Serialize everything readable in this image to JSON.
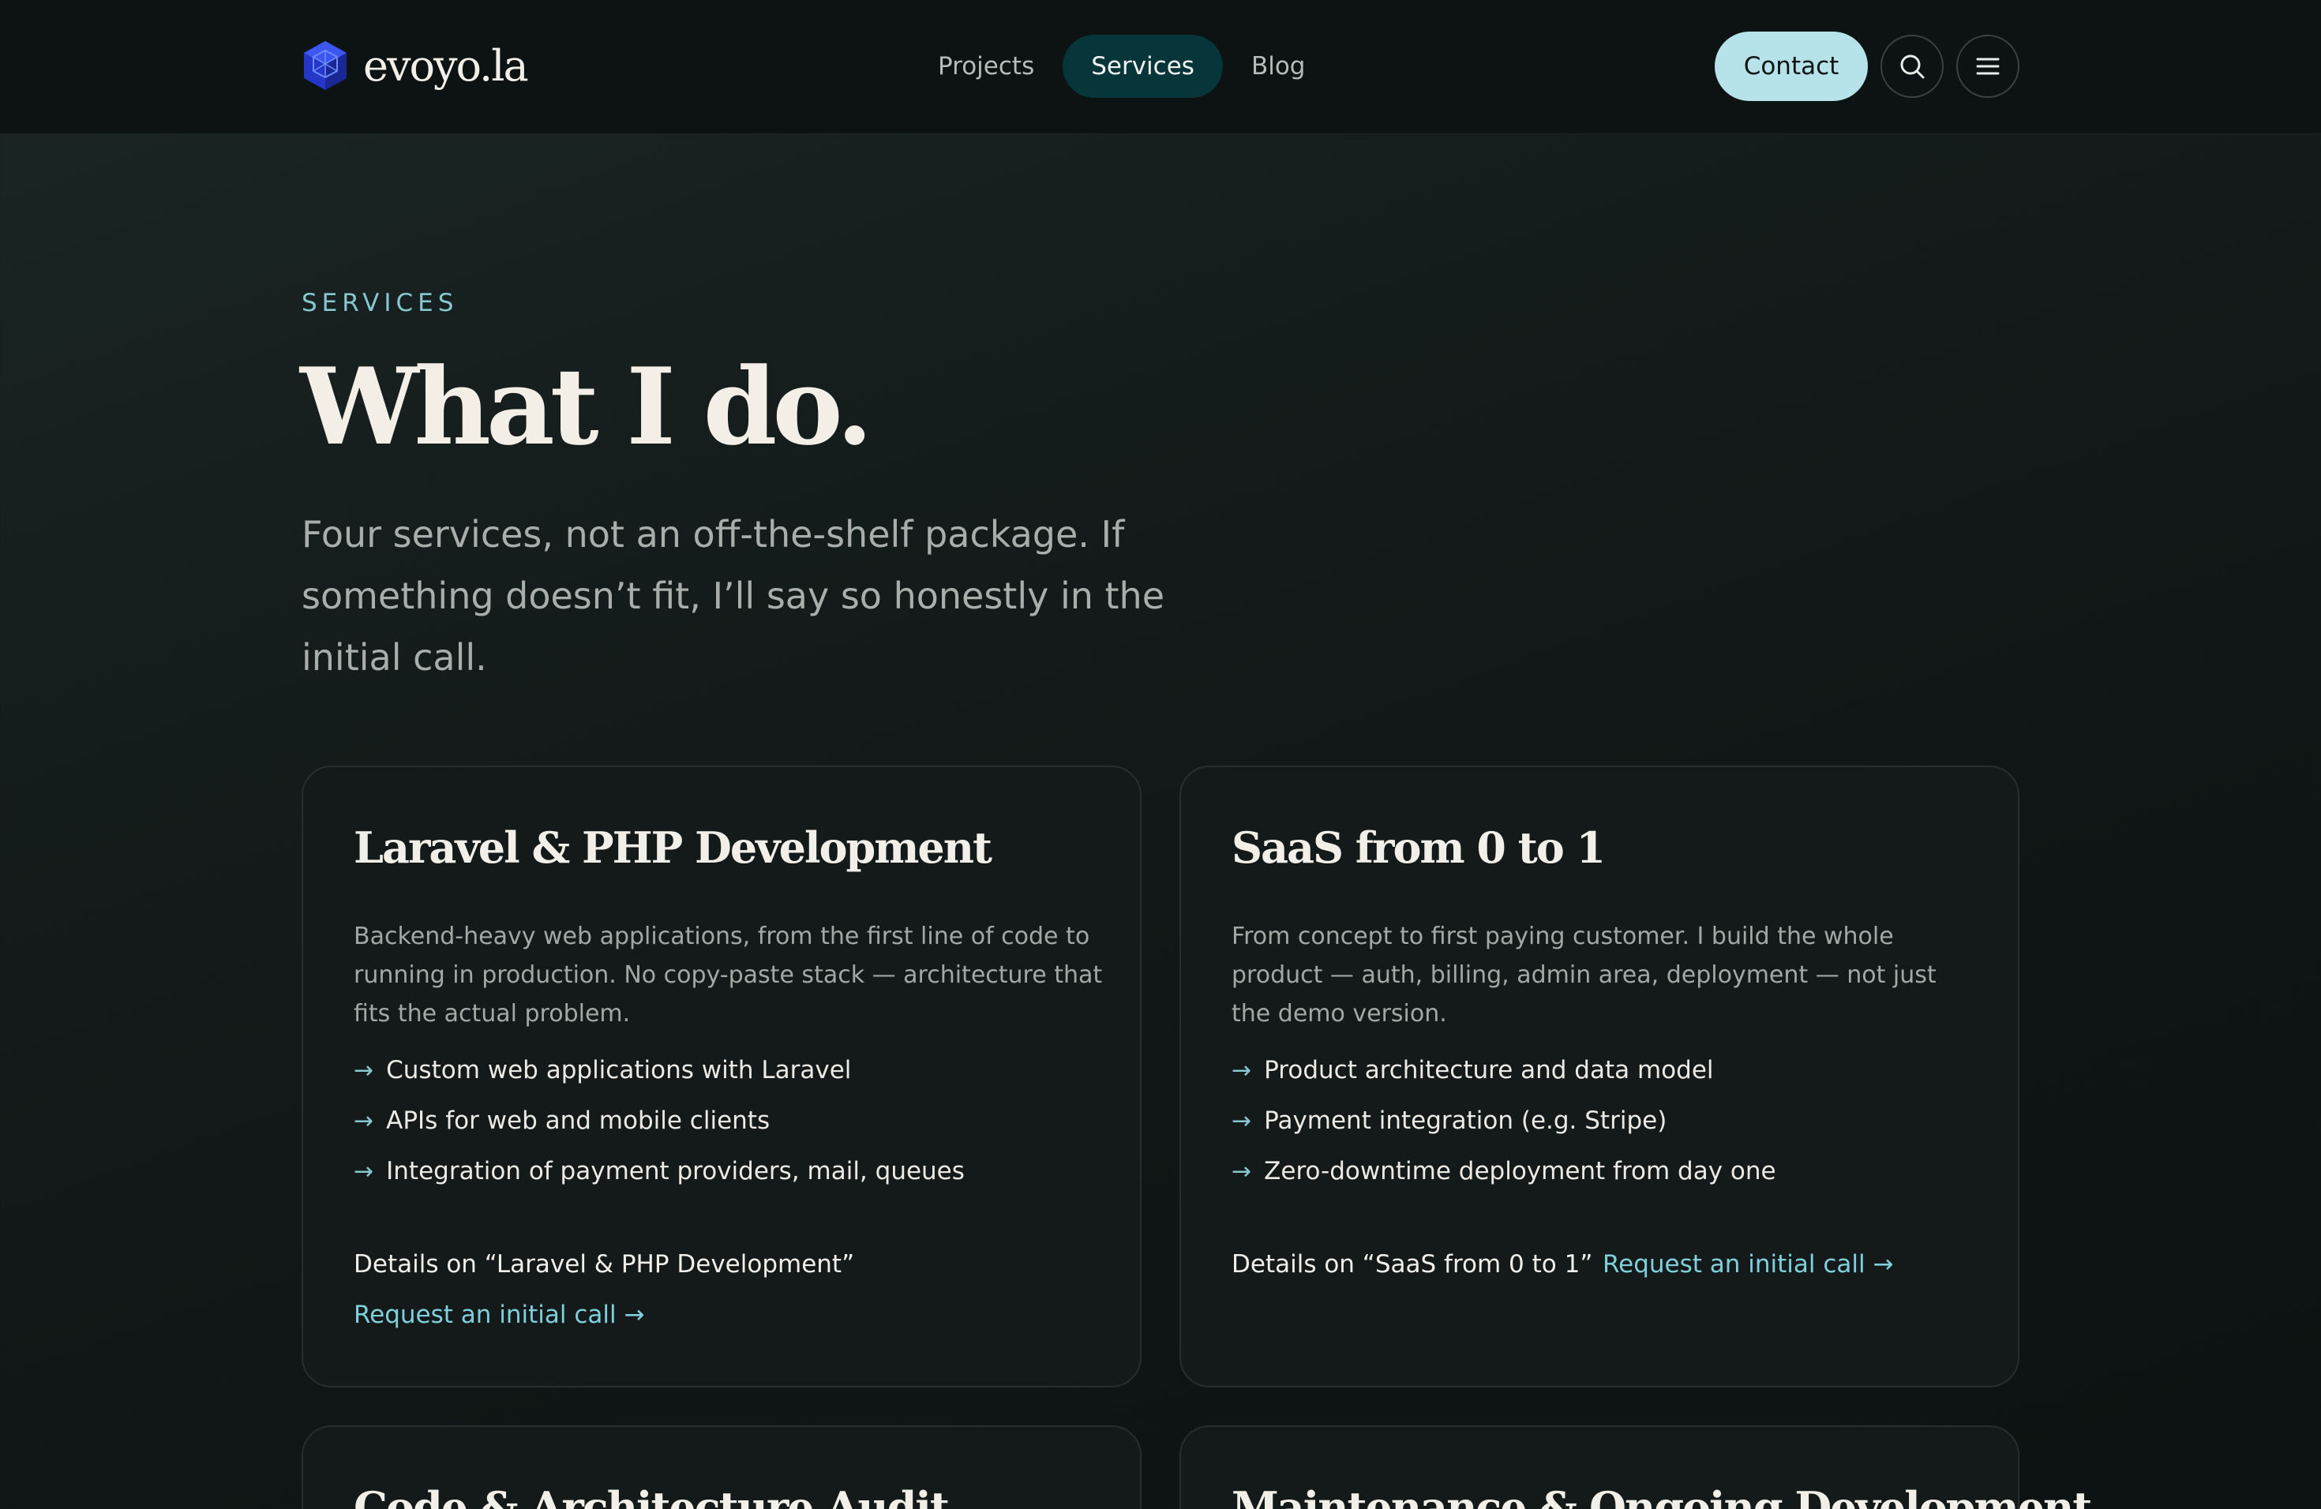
{
  "brand": {
    "name": "evoyo.la",
    "logo_icon": "hexagon-cube-icon",
    "logo_color": "#2b3fd6"
  },
  "nav": {
    "items": [
      {
        "label": "Projects",
        "active": false
      },
      {
        "label": "Services",
        "active": true
      },
      {
        "label": "Blog",
        "active": false
      }
    ],
    "contact_label": "Contact",
    "search_icon": "search-icon",
    "menu_icon": "menu-icon"
  },
  "hero": {
    "eyebrow": "SERVICES",
    "title": "What I do.",
    "intro": "Four services, not an off-the-shelf package. If something doesn’t fit, I’ll say so honestly in the initial call."
  },
  "services": [
    {
      "title": "Laravel & PHP Development",
      "description": "Backend-heavy web applications, from the first line of code to running in production. No copy-paste stack — architecture that fits the actual problem.",
      "features": [
        "Custom web applications with Laravel",
        "APIs for web and mobile clients",
        "Integration of payment providers, mail, queues"
      ],
      "details_link": "Details on “Laravel & PHP Development”",
      "cta_link": "Request an initial call →"
    },
    {
      "title": "SaaS from 0 to 1",
      "description": "From concept to first paying customer. I build the whole product — auth, billing, admin area, deployment — not just the demo version.",
      "features": [
        "Product architecture and data model",
        "Payment integration (e.g. Stripe)",
        "Zero-downtime deployment from day one"
      ],
      "details_link": "Details on “SaaS from 0 to 1”",
      "cta_link": "Request an initial call →"
    },
    {
      "title": "Code & Architecture Audit"
    },
    {
      "title": "Maintenance & Ongoing Development"
    }
  ],
  "feature_arrow": "→",
  "colors": {
    "accent": "#86c7d0",
    "contact_bg": "#b6e3ea",
    "active_nav_bg": "#06353a"
  }
}
